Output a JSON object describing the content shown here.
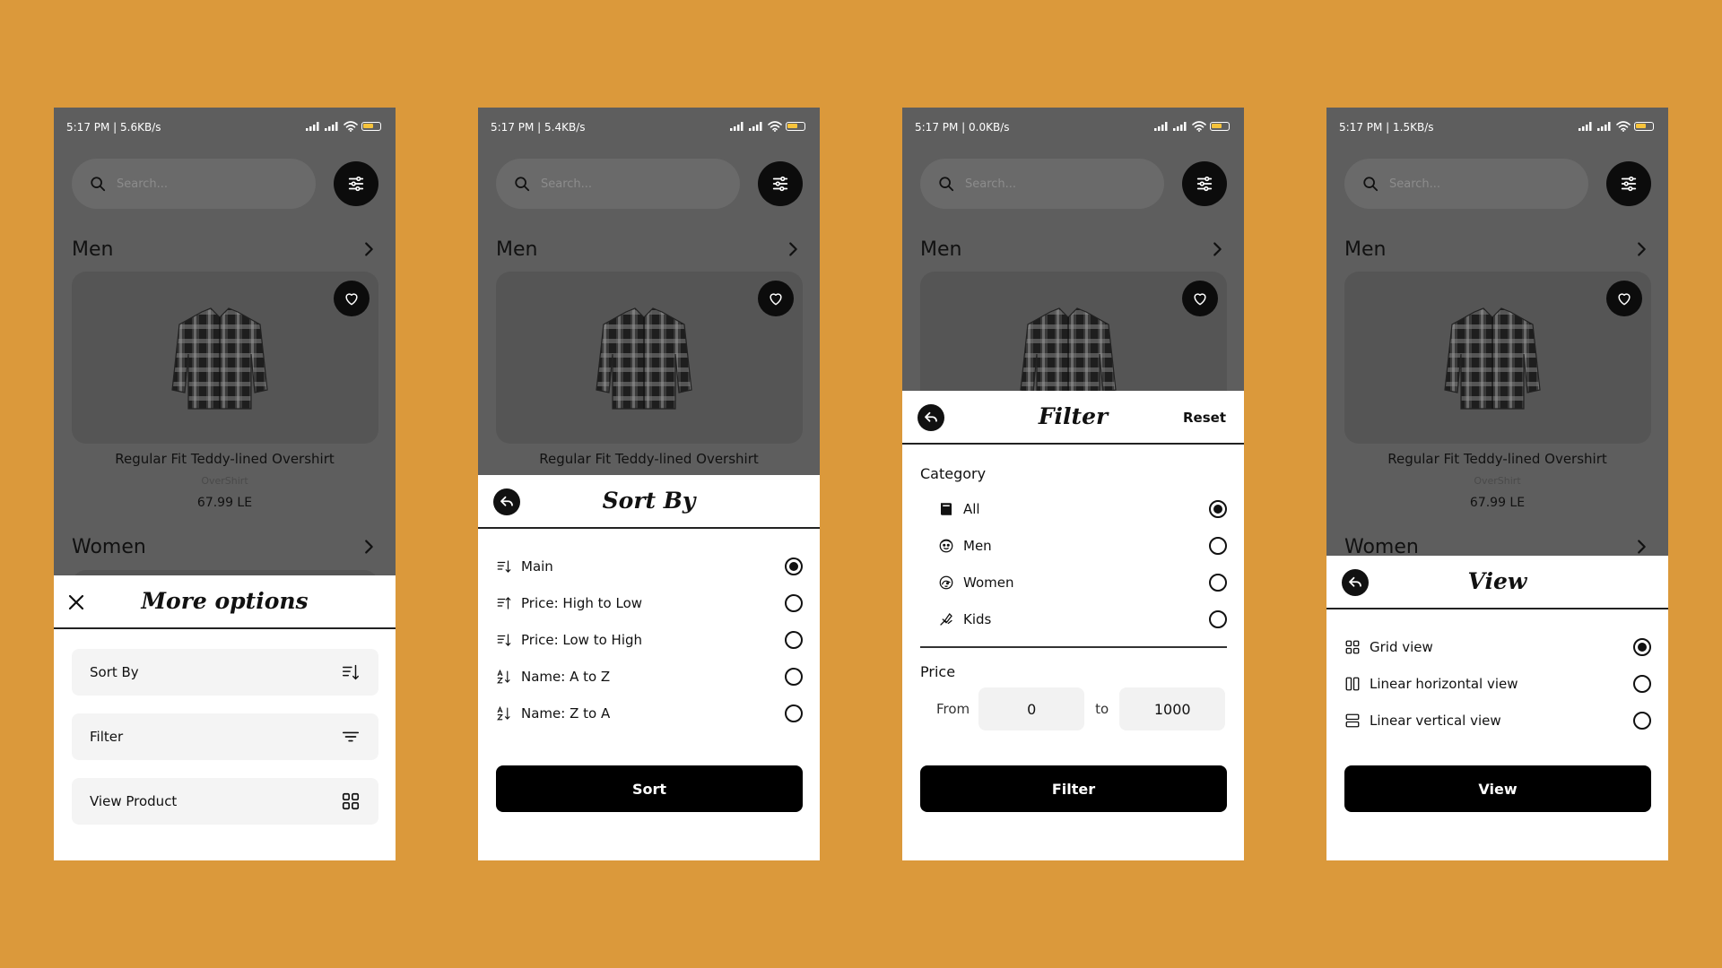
{
  "colors": {
    "background": "#DB993B",
    "overlay": "#5e5e5e",
    "sheet": "#ffffff",
    "primary": "#000000",
    "battery": "#f6c33b"
  },
  "screens": [
    {
      "status_time": "5:17 PM | 5.6KB/s",
      "search_placeholder": "Search...",
      "section_title": "Men",
      "product": {
        "name": "Regular Fit Teddy-lined Overshirt",
        "type": "OverShirt",
        "price": "67.99 LE"
      },
      "section2_title": "Women",
      "sheet": {
        "title": "More options",
        "options": [
          {
            "label": "Sort By",
            "icon": "sort-icon"
          },
          {
            "label": "Filter",
            "icon": "filter-lines-icon"
          },
          {
            "label": "View Product",
            "icon": "grid-icon"
          }
        ]
      }
    },
    {
      "status_time": "5:17 PM | 5.4KB/s",
      "search_placeholder": "Search...",
      "section_title": "Men",
      "product": {
        "name": "Regular Fit Teddy-lined Overshirt"
      },
      "sheet": {
        "title": "Sort By",
        "options": [
          {
            "label": "Main",
            "selected": true
          },
          {
            "label": "Price: High to Low",
            "selected": false
          },
          {
            "label": "Price: Low to High",
            "selected": false
          },
          {
            "label": "Name: A to Z",
            "selected": false
          },
          {
            "label": "Name: Z to A",
            "selected": false
          }
        ],
        "button": "Sort"
      }
    },
    {
      "status_time": "5:17 PM | 0.0KB/s",
      "search_placeholder": "Search...",
      "section_title": "Men",
      "sheet": {
        "title": "Filter",
        "reset": "Reset",
        "category_label": "Category",
        "categories": [
          {
            "label": "All",
            "selected": true
          },
          {
            "label": "Men",
            "selected": false
          },
          {
            "label": "Women",
            "selected": false
          },
          {
            "label": "Kids",
            "selected": false
          }
        ],
        "price_label": "Price",
        "from_label": "From",
        "from_value": "0",
        "to_label": "to",
        "to_value": "1000",
        "button": "Filter"
      }
    },
    {
      "status_time": "5:17 PM | 1.5KB/s",
      "search_placeholder": "Search...",
      "section_title": "Men",
      "product": {
        "name": "Regular Fit Teddy-lined Overshirt",
        "type": "OverShirt",
        "price": "67.99 LE"
      },
      "section2_title": "Women",
      "sheet": {
        "title": "View",
        "options": [
          {
            "label": "Grid view",
            "selected": true
          },
          {
            "label": "Linear horizontal view",
            "selected": false
          },
          {
            "label": "Linear vertical view",
            "selected": false
          }
        ],
        "button": "View"
      }
    }
  ]
}
